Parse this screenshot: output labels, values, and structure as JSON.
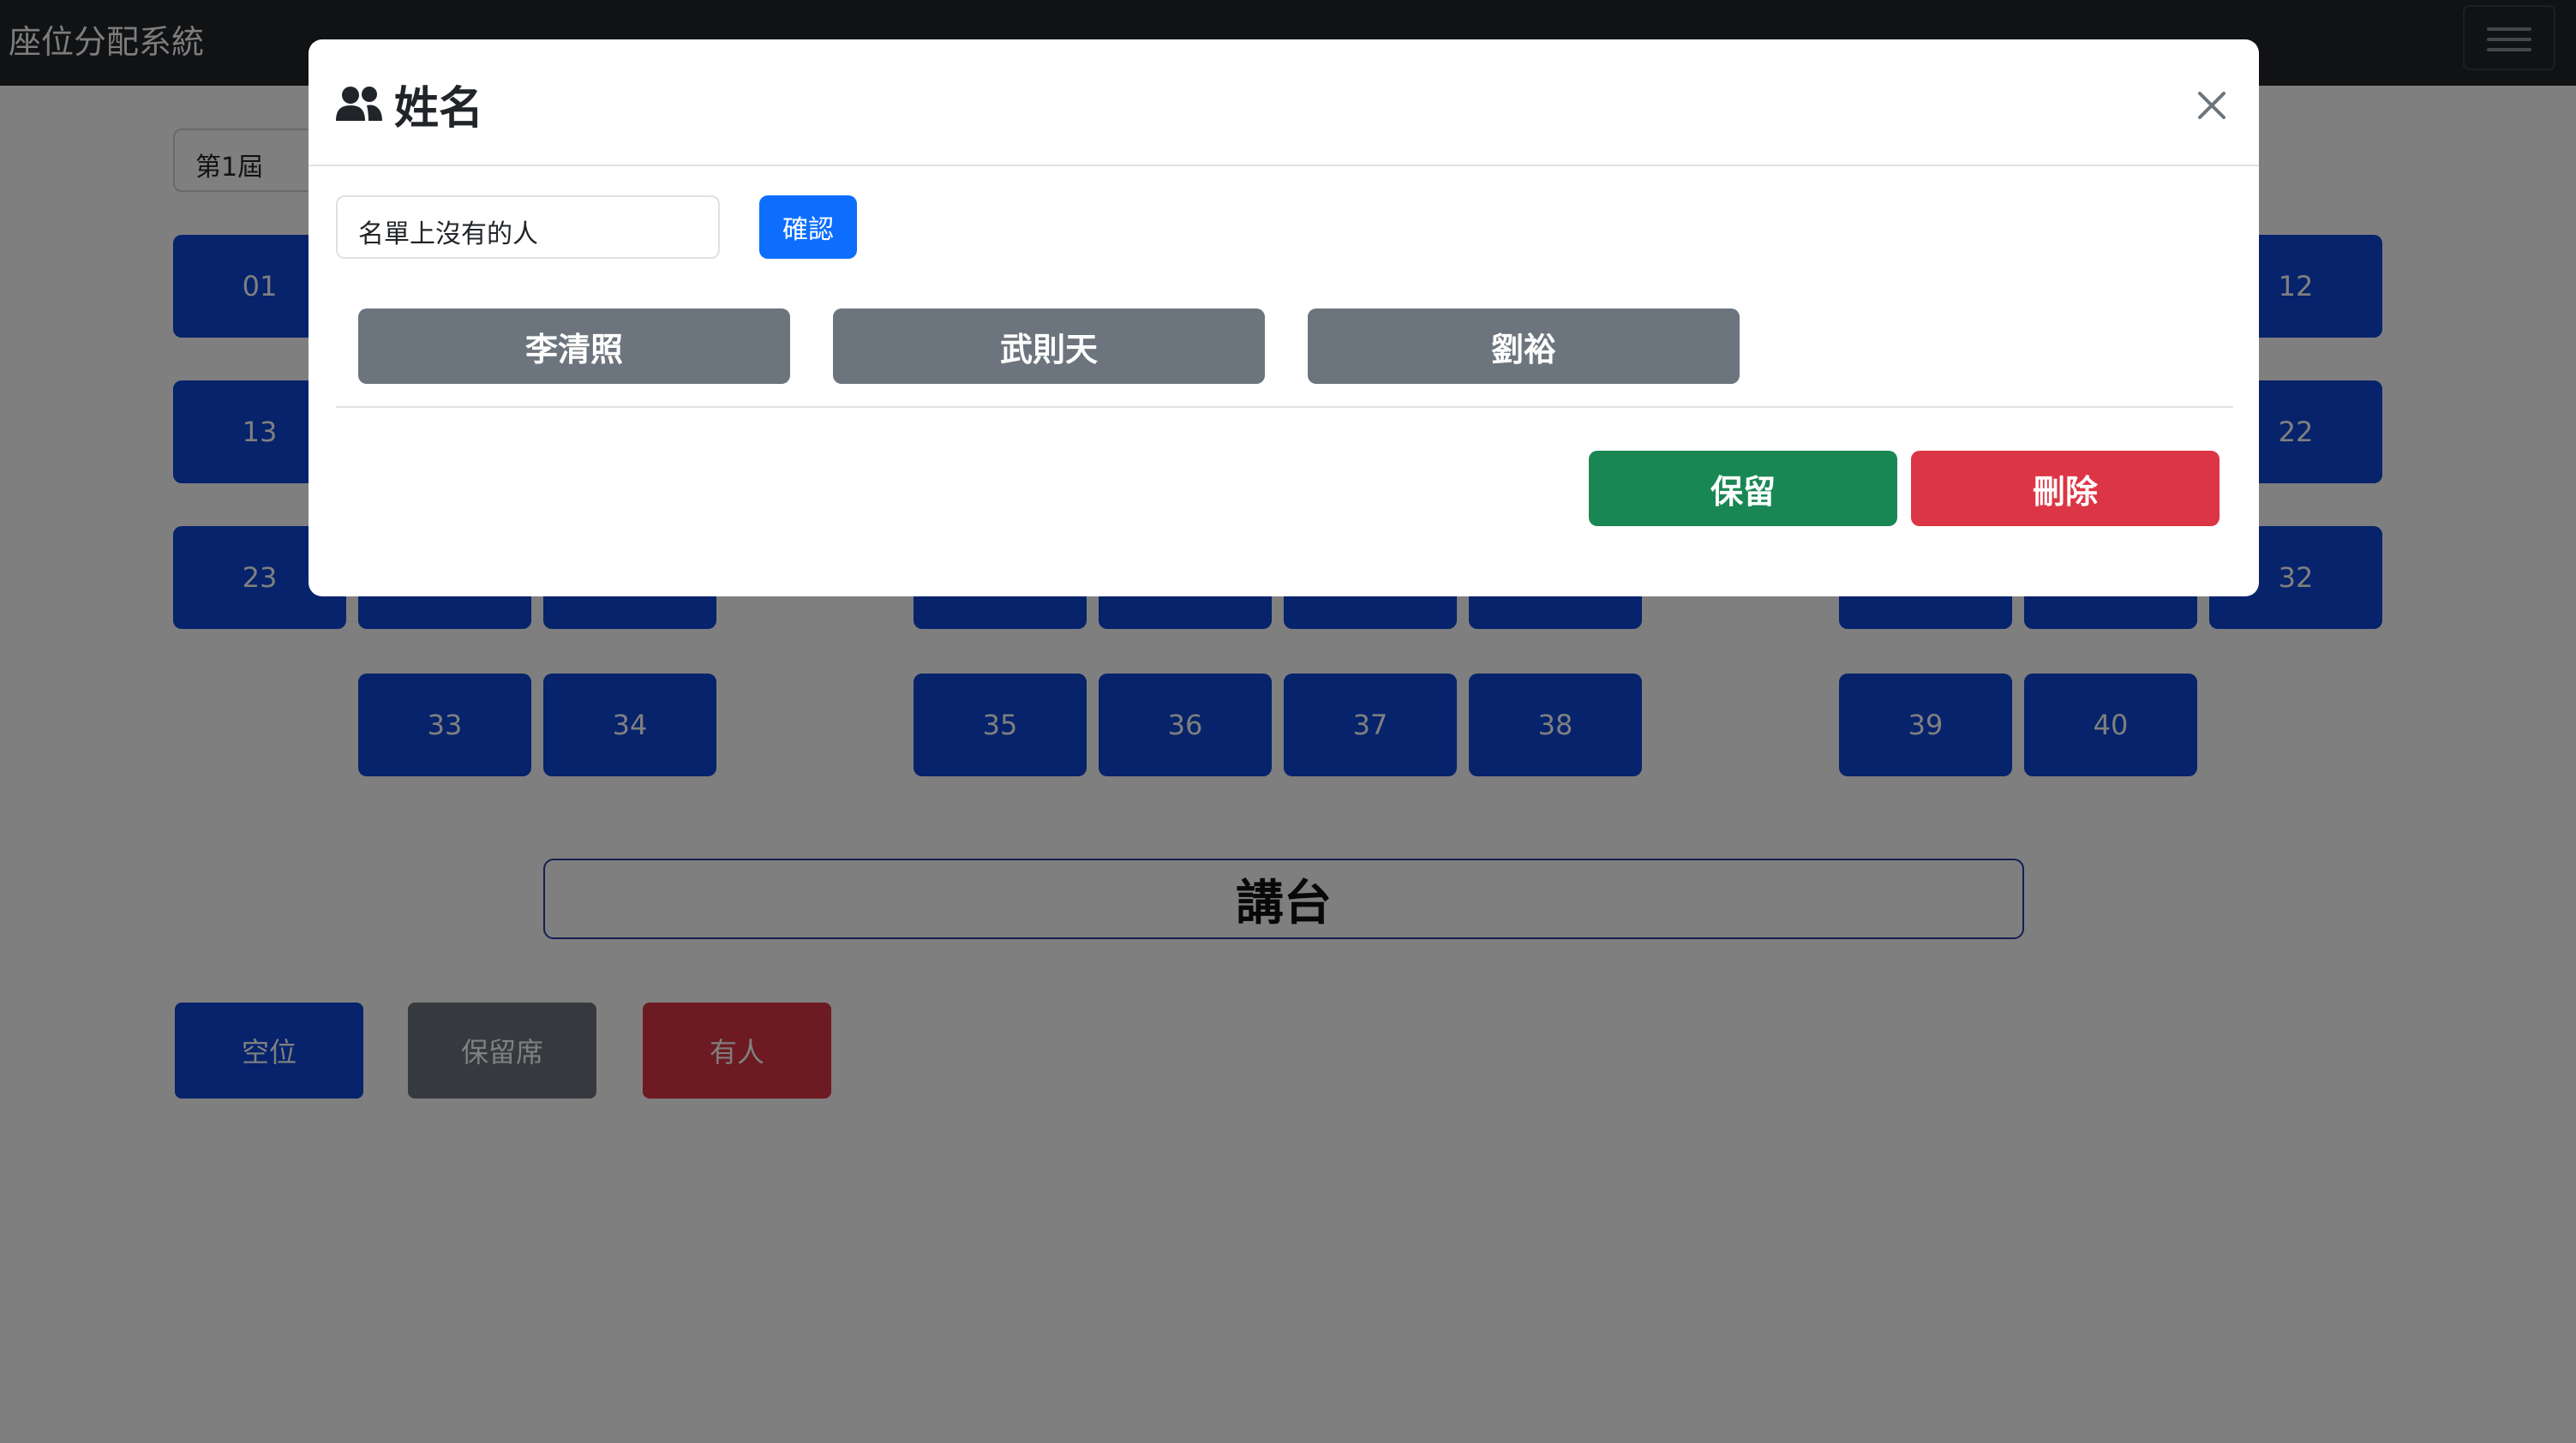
{
  "app": {
    "title": "座位分配系統"
  },
  "page": {
    "term_select": "第1屆",
    "seats": [
      {
        "num": "01",
        "status": "empty"
      },
      {
        "num": "12",
        "status": "empty"
      },
      {
        "num": "13",
        "status": "empty"
      },
      {
        "num": "22",
        "status": "empty"
      },
      {
        "num": "23",
        "status": "empty"
      },
      {
        "num": "32",
        "status": "empty"
      },
      {
        "num": "33",
        "status": "empty"
      },
      {
        "num": "34",
        "status": "empty"
      },
      {
        "num": "35",
        "status": "empty"
      },
      {
        "num": "36",
        "status": "empty"
      },
      {
        "num": "37",
        "status": "empty"
      },
      {
        "num": "38",
        "status": "empty"
      },
      {
        "num": "39",
        "status": "empty"
      },
      {
        "num": "40",
        "status": "empty"
      }
    ],
    "podium": "講台",
    "legend": [
      {
        "label": "空位",
        "color": "#0d47d6"
      },
      {
        "label": "保留席",
        "color": "#6c757d"
      },
      {
        "label": "有人",
        "color": "#dc3545"
      }
    ]
  },
  "modal": {
    "title": "姓名",
    "title_icon": "people-icon",
    "input_value": "名單上沒有的人",
    "confirm_label": "確認",
    "names": [
      "李清照",
      "武則天",
      "劉裕"
    ],
    "reserve_label": "保留",
    "delete_label": "刪除",
    "close_icon": "close-icon"
  },
  "colors": {
    "seat_empty": "#0d47d6",
    "reserved": "#6c757d",
    "occupied": "#dc3545",
    "confirm": "#0d6efd",
    "reserve_button": "#198754",
    "delete_button": "#dc3545"
  }
}
